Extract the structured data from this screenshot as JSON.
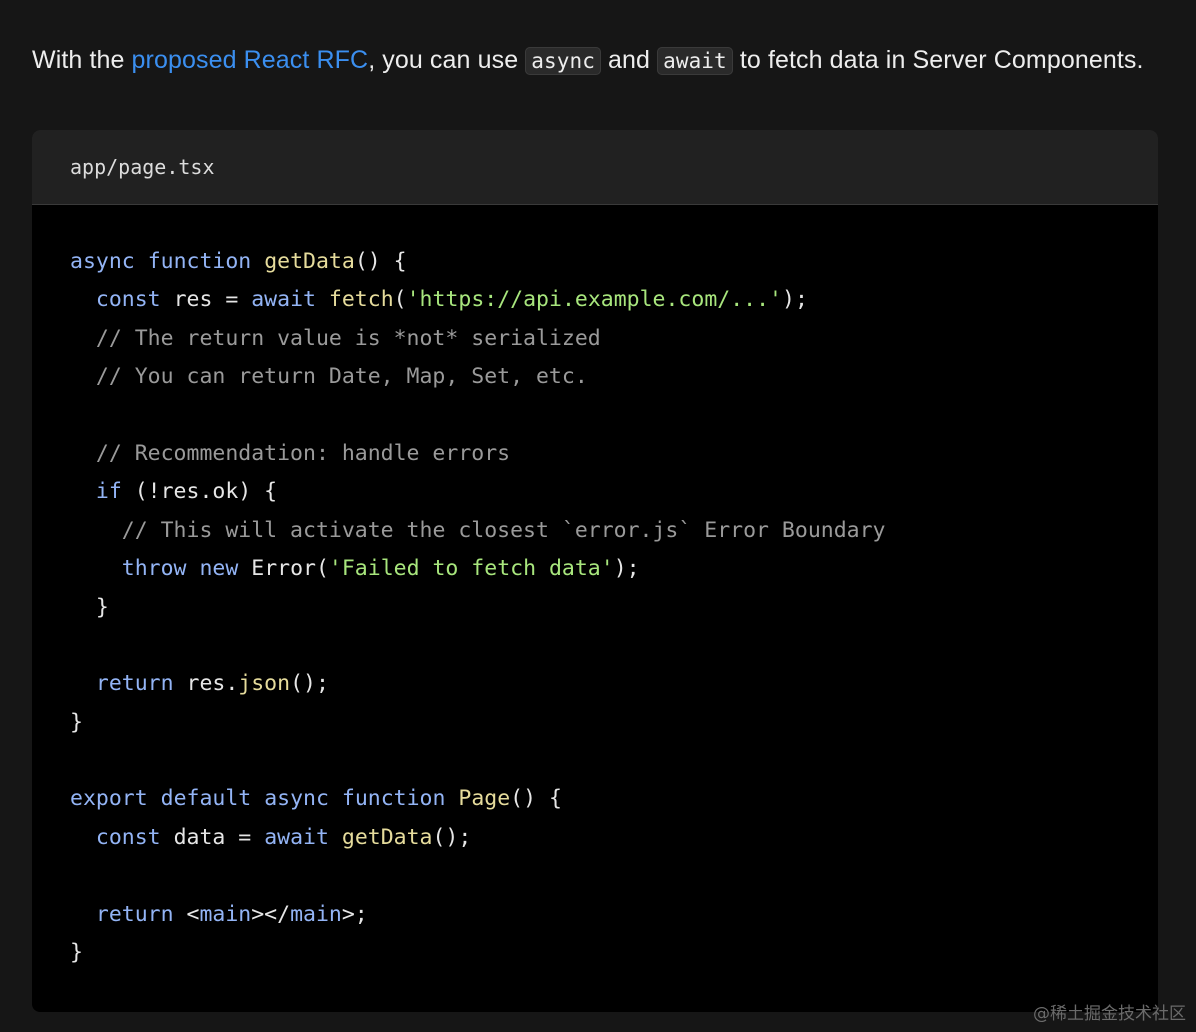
{
  "intro": {
    "before_link": "With the ",
    "link_text": "proposed React RFC",
    "after_link": ", you can use ",
    "code1": "async",
    "between": " and ",
    "code2": "await",
    "after": " to fetch data in Server Components."
  },
  "code_block": {
    "filename": "app/page.tsx",
    "lines": [
      [
        {
          "t": "async",
          "c": "k"
        },
        {
          "t": " "
        },
        {
          "t": "function",
          "c": "k"
        },
        {
          "t": " "
        },
        {
          "t": "getData",
          "c": "f"
        },
        {
          "t": "() {"
        }
      ],
      [
        {
          "t": "  "
        },
        {
          "t": "const",
          "c": "k"
        },
        {
          "t": " res = "
        },
        {
          "t": "await",
          "c": "k"
        },
        {
          "t": " "
        },
        {
          "t": "fetch",
          "c": "f"
        },
        {
          "t": "("
        },
        {
          "t": "'https://api.example.com/...'",
          "c": "s"
        },
        {
          "t": ");"
        }
      ],
      [
        {
          "t": "  "
        },
        {
          "t": "// The return value is *not* serialized",
          "c": "c"
        }
      ],
      [
        {
          "t": "  "
        },
        {
          "t": "// You can return Date, Map, Set, etc.",
          "c": "c"
        }
      ],
      [],
      [
        {
          "t": "  "
        },
        {
          "t": "// Recommendation: handle errors",
          "c": "c"
        }
      ],
      [
        {
          "t": "  "
        },
        {
          "t": "if",
          "c": "k"
        },
        {
          "t": " (!res.ok) {"
        }
      ],
      [
        {
          "t": "    "
        },
        {
          "t": "// This will activate the closest `error.js` Error Boundary",
          "c": "c"
        }
      ],
      [
        {
          "t": "    "
        },
        {
          "t": "throw",
          "c": "k"
        },
        {
          "t": " "
        },
        {
          "t": "new",
          "c": "k"
        },
        {
          "t": " Error("
        },
        {
          "t": "'Failed to fetch data'",
          "c": "s"
        },
        {
          "t": ");"
        }
      ],
      [
        {
          "t": "  }"
        }
      ],
      [],
      [
        {
          "t": "  "
        },
        {
          "t": "return",
          "c": "k"
        },
        {
          "t": " res."
        },
        {
          "t": "json",
          "c": "f"
        },
        {
          "t": "();"
        }
      ],
      [
        {
          "t": "}"
        }
      ],
      [],
      [
        {
          "t": "export",
          "c": "k"
        },
        {
          "t": " "
        },
        {
          "t": "default",
          "c": "k"
        },
        {
          "t": " "
        },
        {
          "t": "async",
          "c": "k"
        },
        {
          "t": " "
        },
        {
          "t": "function",
          "c": "k"
        },
        {
          "t": " "
        },
        {
          "t": "Page",
          "c": "f"
        },
        {
          "t": "() {"
        }
      ],
      [
        {
          "t": "  "
        },
        {
          "t": "const",
          "c": "k"
        },
        {
          "t": " data = "
        },
        {
          "t": "await",
          "c": "k"
        },
        {
          "t": " "
        },
        {
          "t": "getData",
          "c": "f"
        },
        {
          "t": "();"
        }
      ],
      [],
      [
        {
          "t": "  "
        },
        {
          "t": "return",
          "c": "k"
        },
        {
          "t": " <"
        },
        {
          "t": "main",
          "c": "k"
        },
        {
          "t": "></"
        },
        {
          "t": "main",
          "c": "k"
        },
        {
          "t": ">;"
        }
      ],
      [
        {
          "t": "}"
        }
      ]
    ]
  },
  "watermark": "@稀土掘金技术社区"
}
